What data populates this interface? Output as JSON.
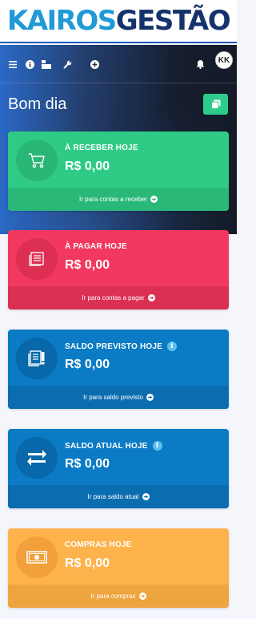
{
  "brand": {
    "part1": "KAIROS",
    "part2": "GESTÃO",
    "color1": "#1f9ad6",
    "color2": "#15326b"
  },
  "topnav": {
    "icons": [
      "menu-icon",
      "info-icon",
      "building-icon",
      "wrench-icon",
      "plus-circle-icon",
      "bell-icon"
    ],
    "avatar_initials": "KK"
  },
  "greeting": "Bom dia",
  "cards": [
    {
      "label": "À RECEBER HOJE",
      "value": "R$ 0,00",
      "link": "Ir para contas a receber",
      "icon": "cart-icon",
      "has_info": false,
      "color": "#2fcb86"
    },
    {
      "label": "À PAGAR HOJE",
      "value": "R$ 0,00",
      "link": "Ir para contas a pagar",
      "icon": "document-list-icon",
      "has_info": false,
      "color": "#f2385e"
    },
    {
      "label": "SALDO PREVISTO HOJE",
      "value": "R$ 0,00",
      "link": "Ir para saldo previsto",
      "icon": "report-alert-icon",
      "has_info": true,
      "color": "#0a7bc4"
    },
    {
      "label": "SALDO ATUAL HOJE",
      "value": "R$ 0,00",
      "link": "Ir para saldo atual",
      "icon": "exchange-arrows-icon",
      "has_info": true,
      "color": "#0a7bc4"
    },
    {
      "label": "COMPRAS HOJE",
      "value": "R$ 0,00",
      "link": "Ir para compras",
      "icon": "money-bill-icon",
      "has_info": false,
      "color": "#feb24b"
    }
  ]
}
